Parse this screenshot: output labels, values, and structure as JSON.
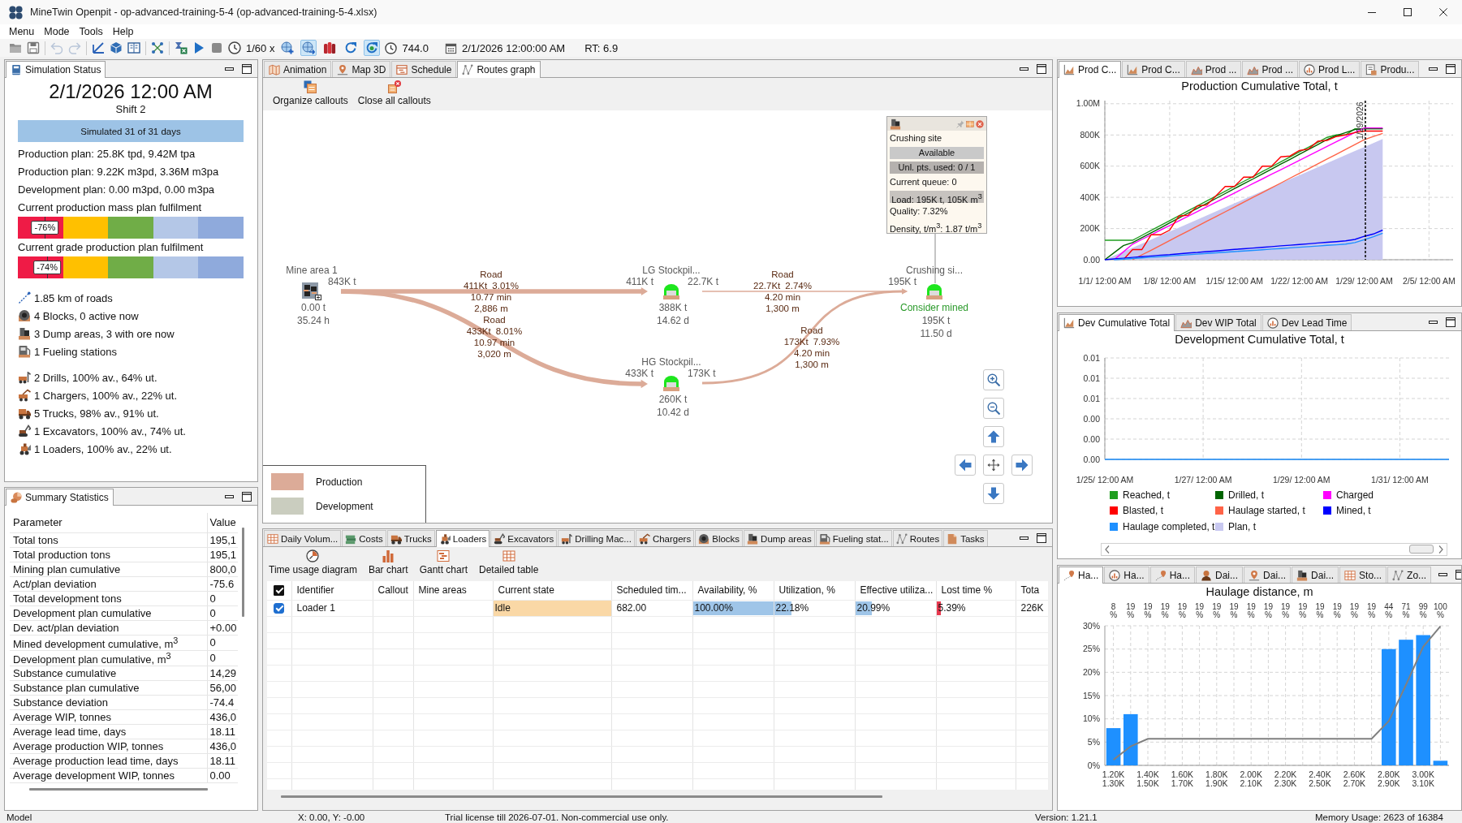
{
  "window": {
    "title": "MineTwin Openpit - op-advanced-training-5-4 (op-advanced-training-5-4.xlsx)"
  },
  "menu": [
    "Menu",
    "Mode",
    "Tools",
    "Help"
  ],
  "toolbar": {
    "tools": [
      {
        "disabled": false
      },
      {
        "disabled": false
      },
      {
        "disabled": true
      },
      {
        "disabled": true
      },
      {
        "disabled": false
      },
      {
        "disabled": false
      },
      {
        "disabled": false
      },
      {
        "disabled": false
      },
      {
        "disabled": false
      },
      {
        "disabled": false
      },
      {
        "disabled": false
      },
      {
        "disabled": false
      }
    ],
    "speed": "1/60 x",
    "toggles": [
      {
        "pressed": false
      },
      {
        "pressed": true
      },
      {
        "pressed": false
      },
      {
        "pressed": false
      },
      {
        "pressed": true
      }
    ],
    "model_time": "744.0",
    "date": "2/1/2026 12:00:00 AM",
    "realtime": "RT: 6.9"
  },
  "simulation_status": {
    "tabs": [
      {
        "label": "Simulation Status",
        "selected": true
      }
    ],
    "datetime": "2/1/2026 12:00 AM",
    "shift": "Shift 2",
    "progress": {
      "text": "Simulated 31 of 31 days",
      "level": 1
    },
    "plans": [
      "Production plan: 25.8K tpd, 9.42M tpa",
      "Production plan: 9.22K m3pd, 3.36M m3pa",
      "Development plan: 0.00 m3pd, 0.00 m3pa"
    ],
    "gauges": [
      {
        "label": "Current production mass plan fulfilment",
        "value": "-76%",
        "level": 0.12
      },
      {
        "label": "Current grade production plan fulfilment",
        "value": "-74%",
        "level": 0.13
      }
    ],
    "infrastructure": [
      "1.85 km of roads",
      "4 Blocks, 0 active now",
      "3 Dump areas, 3 with ore now",
      "1 Fueling stations"
    ],
    "equipment": [
      "2 Drills, 100% av., 64% ut.",
      "1 Chargers, 100% av., 22% ut.",
      "5 Trucks, 98% av., 91% ut.",
      "1 Excavators, 100% av., 74% ut.",
      "1 Loaders, 100% av., 22% ut."
    ]
  },
  "summary_statistics": {
    "tabs": [
      {
        "label": "Summary Statistics",
        "selected": true
      }
    ],
    "columns": [
      "Parameter",
      "Value"
    ],
    "rows": [
      [
        "Total tons",
        "195,1"
      ],
      [
        "Total production tons",
        "195,1"
      ],
      [
        "Mining plan cumulative",
        "800,0"
      ],
      [
        "Act/plan deviation",
        "-75.6"
      ],
      [
        "Total development tons",
        "0"
      ],
      [
        "Development plan cumulative",
        "0"
      ],
      [
        "Dev. act/plan deviation",
        "+0.00"
      ],
      [
        "Mined development cumulative, m$^{3}$",
        "0"
      ],
      [
        "Development plan cumulative, m$^{3}$",
        "0"
      ],
      [
        "Substance cumulative",
        "14,29"
      ],
      [
        "Substance plan cumulative",
        "56,00"
      ],
      [
        "Substance deviation",
        "-74.4"
      ],
      [
        "Average WIP, tonnes",
        "436,0"
      ],
      [
        "Average lead time, days",
        "18.11"
      ],
      [
        "Average production WIP, tonnes",
        "436,0"
      ],
      [
        "Average production lead time, days",
        "18.11"
      ],
      [
        "Average development WIP, tonnes",
        "0.00"
      ]
    ]
  },
  "routes_panel": {
    "tabs": [
      {
        "label": "Animation",
        "selected": false
      },
      {
        "label": "Map 3D",
        "selected": false
      },
      {
        "label": "Schedule",
        "selected": false
      },
      {
        "label": "Routes graph",
        "selected": true
      }
    ],
    "actions": [
      "Organize callouts",
      "Close all callouts"
    ],
    "nodes": [
      {
        "kind": "mine_area",
        "name": "Mine area 1",
        "outflow": "843K t",
        "details": [
          "0.00 t",
          "35.24 h"
        ]
      },
      {
        "kind": "dump_area",
        "name": "LG Stockpil...",
        "inflow": "411K t",
        "outflow": "22.7K t",
        "details": [
          "388K t",
          "14.62 d"
        ]
      },
      {
        "kind": "dump_area",
        "name": "HG Stockpil...",
        "inflow": "433K t",
        "outflow": "173K t",
        "details": [
          "260K t",
          "10.42 d"
        ]
      },
      {
        "kind": "dump_area",
        "name": "Crushing si...",
        "inflow": "195K t",
        "status": "Consider mined",
        "details": [
          "195K t",
          "11.50 d"
        ]
      }
    ],
    "edges": [
      {
        "kind": "production",
        "label": "Road",
        "load": "411Kt",
        "grade": "3.01%",
        "time": "10.77 min",
        "length": "2,886 m"
      },
      {
        "kind": "production",
        "label": "Road",
        "load": "433Kt",
        "grade": "8.01%",
        "time": "10.97 min",
        "length": "3,020 m"
      },
      {
        "kind": "production",
        "label": "Road",
        "load": "22.7Kt",
        "grade": "2.74%",
        "time": "4.20 min",
        "length": "1,300 m"
      },
      {
        "kind": "production",
        "label": "Road",
        "load": "173Kt",
        "grade": "7.93%",
        "time": "4.20 min",
        "length": "1,300 m"
      }
    ],
    "callout": {
      "title": "Crushing site",
      "rows": [
        {
          "kind": "badge",
          "text": "Available",
          "color": "#c9c9c9"
        },
        {
          "kind": "badge",
          "text": "Unl. pts. used: 0 / 1",
          "color": "#b5b1ae"
        },
        {
          "kind": "plain",
          "text": "Current queue: 0"
        },
        {
          "kind": "badge",
          "text": "Load: 195K t, 105K m$^{3}$",
          "color": "#c7c3bf"
        },
        {
          "kind": "plain",
          "text": "Quality: 7.32%"
        },
        {
          "kind": "plain",
          "text": "Density, t/m$^{3}$: 1.87 t/m$^{3}$"
        }
      ]
    },
    "legend": [
      {
        "label": "Production",
        "color": "#dcab98"
      },
      {
        "label": "Development",
        "color": "#cacdbf"
      }
    ]
  },
  "loaders_panel": {
    "tabs": [
      {
        "label": "Daily Volum...",
        "selected": false
      },
      {
        "label": "Costs",
        "selected": false
      },
      {
        "label": "Trucks",
        "selected": false
      },
      {
        "label": "Loaders",
        "selected": true
      },
      {
        "label": "Excavators",
        "selected": false
      },
      {
        "label": "Drilling Mac...",
        "selected": false
      },
      {
        "label": "Chargers",
        "selected": false
      },
      {
        "label": "Blocks",
        "selected": false
      },
      {
        "label": "Dump areas",
        "selected": false
      },
      {
        "label": "Fueling stat...",
        "selected": false
      },
      {
        "label": "Routes",
        "selected": false
      },
      {
        "label": "Tasks",
        "selected": false
      }
    ],
    "actions": [
      "Time usage diagram",
      "Bar chart",
      "Gantt chart",
      "Detailed table"
    ],
    "select_all": {
      "checked": true
    },
    "columns": [
      "Identifier",
      "Callout",
      "Mine areas",
      "Current state",
      "Scheduled tim...",
      "Availability, %",
      "Utilization, %",
      "Effective utiliza...",
      "Lost time %",
      "Tota"
    ],
    "rows": [
      {
        "checked": true,
        "cells": [
          {
            "kind": "text",
            "text": "Loader 1"
          },
          {
            "kind": "empty"
          },
          {
            "kind": "empty"
          },
          {
            "kind": "state",
            "text": "Idle",
            "color": "#fad8a6"
          },
          {
            "kind": "text",
            "text": "682.00"
          },
          {
            "kind": "bar",
            "text": "100.00%",
            "level": 1,
            "color": "#9fc5e8"
          },
          {
            "kind": "bar",
            "text": "22.18%",
            "level": 0.22,
            "color": "#9fc5e8"
          },
          {
            "kind": "bar",
            "text": "20.99%",
            "level": 0.21,
            "color": "#9fc5e8"
          },
          {
            "kind": "bar",
            "text": "5.39%",
            "level": 0.06,
            "color": "#e8394f"
          },
          {
            "kind": "text",
            "text": "226K"
          }
        ]
      }
    ]
  },
  "production_panel": {
    "tabs": [
      {
        "label": "Prod C...",
        "selected": true
      },
      {
        "label": "Prod C...",
        "selected": false
      },
      {
        "label": "Prod ...",
        "selected": false
      },
      {
        "label": "Prod ...",
        "selected": false
      },
      {
        "label": "Prod L...",
        "selected": false
      },
      {
        "label": "Produ...",
        "selected": false
      }
    ],
    "chart_data": {
      "type": "line",
      "title": "Production Cumulative Total, t",
      "grid": true,
      "categories": [
        "1/1/ 12:00 AM",
        null,
        null,
        null,
        null,
        null,
        null,
        "1/8/ 12:00 AM",
        null,
        null,
        null,
        null,
        null,
        null,
        "1/15/ 12:00 AM",
        null,
        null,
        null,
        null,
        null,
        null,
        "1/22/ 12:00 AM",
        null,
        null,
        null,
        null,
        null,
        null,
        "1/29/ 12:00 AM",
        null,
        null,
        null,
        null,
        null,
        null,
        "2/5/ 12:00 AM"
      ],
      "ylim": [
        0,
        1020000
      ],
      "yticks": [
        {
          "value": 0,
          "label": "0.00"
        },
        {
          "value": 200000,
          "label": "200K"
        },
        {
          "value": 400000,
          "label": "400K"
        },
        {
          "value": 600000,
          "label": "600K"
        },
        {
          "value": 800000,
          "label": "800K"
        },
        {
          "value": 1000000,
          "label": "1.00M"
        }
      ],
      "series": [
        {
          "type": "line",
          "color": "#1f9e1f",
          "values": [
            125000,
            125000,
            125000,
            125000,
            156000,
            188000,
            219000,
            251000,
            282000,
            314000,
            345000,
            376000,
            408000,
            439000,
            471000,
            502000,
            533000,
            565000,
            596000,
            628000,
            659000,
            691000,
            722000,
            753000,
            785000,
            800000,
            800000,
            840000,
            840000,
            840000,
            840000,
            null,
            null,
            null,
            null,
            null
          ]
        },
        {
          "type": "line",
          "color": "#006400",
          "values": [
            0,
            45000,
            90000,
            110000,
            141000,
            173000,
            204000,
            236000,
            267000,
            299000,
            330000,
            361000,
            393000,
            424000,
            456000,
            487000,
            518000,
            550000,
            581000,
            613000,
            644000,
            676000,
            707000,
            738000,
            770000,
            795000,
            815000,
            835000,
            840000,
            840000,
            840000,
            null,
            null,
            null,
            null,
            null
          ]
        },
        {
          "type": "line",
          "color": "#ff00ff",
          "values": [
            null,
            0,
            50000,
            100000,
            130000,
            160000,
            190000,
            219000,
            249000,
            279000,
            309000,
            339000,
            369000,
            398000,
            428000,
            458000,
            488000,
            518000,
            548000,
            577000,
            607000,
            637000,
            667000,
            697000,
            727000,
            756000,
            786000,
            816000,
            845000,
            845000,
            845000,
            null,
            null,
            null,
            null,
            null
          ]
        },
        {
          "type": "line",
          "color": "#ff0000",
          "values": [
            null,
            null,
            0,
            65000,
            65000,
            160000,
            160000,
            190000,
            280000,
            285000,
            345000,
            350000,
            410000,
            470000,
            470000,
            530000,
            530000,
            600000,
            600000,
            660000,
            665000,
            700000,
            710000,
            760000,
            765000,
            790000,
            800000,
            815000,
            825000,
            825000,
            825000,
            null,
            null,
            null,
            null,
            null
          ]
        },
        {
          "type": "line",
          "color": "#ff6347",
          "values": [
            null,
            null,
            null,
            0,
            31000,
            61000,
            92000,
            123000,
            154000,
            184000,
            215000,
            246000,
            277000,
            307000,
            338000,
            369000,
            400000,
            430000,
            461000,
            492000,
            523000,
            553000,
            584000,
            615000,
            646000,
            676000,
            707000,
            738000,
            769000,
            790000,
            810000,
            null,
            null,
            null,
            null,
            null
          ]
        },
        {
          "type": "line",
          "color": "#0000ff",
          "values": [
            0,
            5000,
            10000,
            15000,
            20000,
            24000,
            29000,
            33000,
            38000,
            43000,
            47000,
            52000,
            56000,
            61000,
            66000,
            70000,
            75000,
            79000,
            84000,
            89000,
            93000,
            98000,
            102000,
            107000,
            112000,
            116000,
            121000,
            130000,
            150000,
            165000,
            190000,
            null,
            null,
            null,
            null,
            null
          ]
        },
        {
          "type": "line",
          "color": "#1e90ff",
          "values": [
            null,
            0,
            4000,
            8000,
            12000,
            16000,
            20000,
            24000,
            28000,
            32000,
            36000,
            40000,
            44000,
            48000,
            52000,
            56000,
            60000,
            64000,
            68000,
            72000,
            76000,
            80000,
            84000,
            88000,
            92000,
            96000,
            100000,
            110000,
            128000,
            148000,
            170000,
            null,
            null,
            null,
            null,
            null
          ]
        },
        {
          "type": "area",
          "color": "#c8c8f0",
          "values": [
            0,
            26000,
            52000,
            77000,
            103000,
            129000,
            155000,
            181000,
            206000,
            232000,
            258000,
            284000,
            310000,
            335000,
            361000,
            387000,
            413000,
            439000,
            464000,
            490000,
            516000,
            542000,
            568000,
            593000,
            619000,
            645000,
            671000,
            697000,
            722000,
            748000,
            774000,
            null,
            null,
            null,
            null,
            null
          ]
        }
      ],
      "ref_lines": [
        {
          "axis": "x",
          "value": "1/29/ 12:00 AM",
          "label": "1/29/2026"
        }
      ]
    }
  },
  "development_panel": {
    "tabs": [
      {
        "label": "Dev Cumulative Total",
        "selected": true
      },
      {
        "label": "Dev WIP Total",
        "selected": false
      },
      {
        "label": "Dev Lead Time",
        "selected": false
      }
    ],
    "chart_data": {
      "type": "line",
      "title": "Development Cumulative Total, t",
      "grid": true,
      "legend": "bottom",
      "categories": [
        "1/25/ 12:00 AM",
        null,
        "1/27/ 12:00 AM",
        null,
        "1/29/ 12:00 AM",
        null,
        "1/31/ 12:00 AM",
        null
      ],
      "ylim": [
        0,
        0.01
      ],
      "yticks": [
        {
          "value": 0,
          "label": "0.00"
        },
        {
          "value": 0.002,
          "label": "0.00"
        },
        {
          "value": 0.004,
          "label": "0.00"
        },
        {
          "value": 0.006,
          "label": "0.01"
        },
        {
          "value": 0.008,
          "label": "0.01"
        },
        {
          "value": 0.01,
          "label": "0.01"
        }
      ],
      "series": [
        {
          "name": "Reached, t",
          "type": "line",
          "color": "#1f9e1f",
          "values": [
            null,
            null,
            null,
            null,
            null,
            null,
            null,
            null
          ]
        },
        {
          "name": "Drilled, t",
          "type": "line",
          "color": "#006400",
          "values": [
            null,
            null,
            null,
            null,
            null,
            null,
            null,
            null
          ]
        },
        {
          "name": "Charged",
          "type": "line",
          "color": "#ff00ff",
          "values": [
            null,
            null,
            null,
            null,
            null,
            null,
            null,
            null
          ]
        },
        {
          "name": "Blasted, t",
          "type": "line",
          "color": "#ff0000",
          "values": [
            null,
            null,
            null,
            null,
            null,
            null,
            null,
            null
          ]
        },
        {
          "name": "Haulage started, t",
          "type": "line",
          "color": "#ff6347",
          "values": [
            null,
            null,
            null,
            null,
            null,
            null,
            null,
            null
          ]
        },
        {
          "name": "Mined, t",
          "type": "line",
          "color": "#0000ff",
          "values": [
            null,
            null,
            null,
            null,
            null,
            null,
            null,
            null
          ]
        },
        {
          "name": "Haulage completed, t",
          "type": "line",
          "color": "#1e90ff",
          "values": [
            0,
            0,
            0,
            0,
            0,
            0,
            0,
            0
          ]
        },
        {
          "name": "Plan, t",
          "type": "area",
          "color": "#c8c8f0",
          "values": [
            null,
            null,
            null,
            null,
            null,
            null,
            null,
            null
          ]
        }
      ]
    }
  },
  "haulage_panel": {
    "tabs": [
      {
        "label": "Ha...",
        "selected": true
      },
      {
        "label": "Ha...",
        "selected": false
      },
      {
        "label": "Ha...",
        "selected": false
      },
      {
        "label": "Dai...",
        "selected": false
      },
      {
        "label": "Dai...",
        "selected": false
      },
      {
        "label": "Dai...",
        "selected": false
      },
      {
        "label": "Sto...",
        "selected": false
      },
      {
        "label": "Zo...",
        "selected": false
      }
    ],
    "chart_data": {
      "type": "bar",
      "title": "Haulage distance, m",
      "grid": true,
      "categories": [
        "1.20K 1.30K",
        null,
        "1.40K 1.50K",
        null,
        "1.60K 1.70K",
        null,
        "1.80K 1.90K",
        null,
        "2.00K 2.10K",
        null,
        "2.20K 2.30K",
        null,
        "2.40K 2.50K",
        null,
        "2.60K 2.70K",
        null,
        "2.80K 2.90K",
        null,
        "3.00K 3.10K",
        null
      ],
      "ylim": [
        0,
        30
      ],
      "yticks": [
        {
          "value": 0,
          "label": "0%"
        },
        {
          "value": 5,
          "label": "5%"
        },
        {
          "value": 10,
          "label": "10%"
        },
        {
          "value": 15,
          "label": "15%"
        },
        {
          "value": 20,
          "label": "20%"
        },
        {
          "value": 25,
          "label": "25%"
        },
        {
          "value": 30,
          "label": "30%"
        }
      ],
      "series": [
        {
          "type": "bar",
          "color": "#1e90ff",
          "values": [
            8,
            11,
            0,
            0,
            0,
            0,
            0,
            0,
            0,
            0,
            0,
            0,
            0,
            0,
            0,
            0,
            25,
            27,
            28,
            1
          ]
        },
        {
          "type": "line",
          "color": "#808080",
          "values": [
            1.2,
            4.1,
            5.7,
            5.7,
            5.7,
            5.7,
            5.7,
            5.7,
            5.7,
            5.7,
            5.7,
            5.7,
            5.7,
            5.7,
            5.7,
            5.7,
            9.5,
            17.3,
            25.5,
            29.9
          ]
        }
      ],
      "value_labels": [
        "8 %",
        "19 %",
        "19 %",
        "19 %",
        "19 %",
        "19 %",
        "19 %",
        "19 %",
        "19 %",
        "19 %",
        "19 %",
        "19 %",
        "19 %",
        "19 %",
        "19 %",
        "19 %",
        "44 %",
        "71 %",
        "99 %",
        "100 %"
      ]
    }
  },
  "status_bar": {
    "mode": "Model",
    "coordinates": "X: 0.00, Y: -0.00",
    "license": "Trial license till 2026-07-01. Non-commercial use only.",
    "version": "Version: 1.21.1",
    "memory": "Memory Usage: 2623 of 16384"
  }
}
